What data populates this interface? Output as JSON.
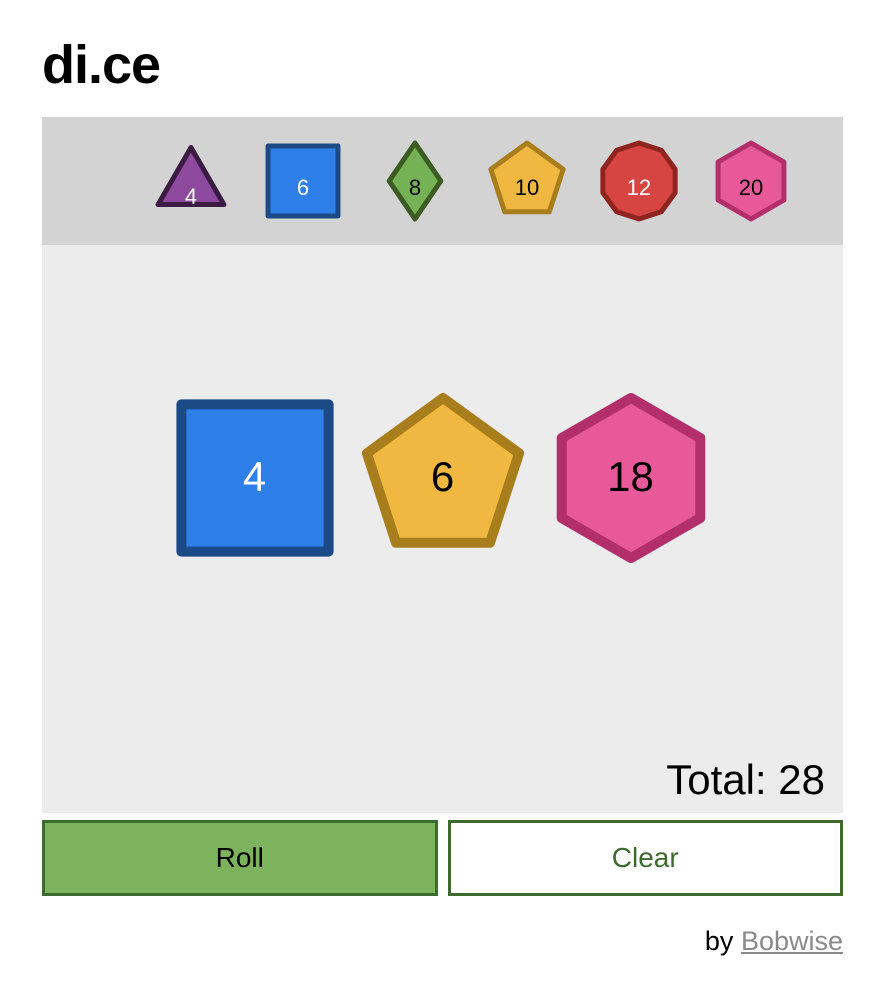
{
  "app": {
    "title": "di.ce"
  },
  "picker": {
    "dice": [
      {
        "sides": "4",
        "label": "4",
        "shape": "triangle",
        "fill": "#8e4a9e",
        "stroke": "#3b1b42",
        "text_color": "#ffffff",
        "icon": "d4-triangle-icon"
      },
      {
        "sides": "6",
        "label": "6",
        "shape": "square",
        "fill": "#2f7fe8",
        "stroke": "#1b4a87",
        "text_color": "#ffffff",
        "icon": "d6-square-icon"
      },
      {
        "sides": "8",
        "label": "8",
        "shape": "diamond",
        "fill": "#74b255",
        "stroke": "#3c5c23",
        "text_color": "#000000",
        "icon": "d8-diamond-icon"
      },
      {
        "sides": "10",
        "label": "10",
        "shape": "pentagon",
        "fill": "#f0b840",
        "stroke": "#a87d1b",
        "text_color": "#000000",
        "icon": "d10-pentagon-icon"
      },
      {
        "sides": "12",
        "label": "12",
        "shape": "decagon",
        "fill": "#d64541",
        "stroke": "#8f2420",
        "text_color": "#ffffff",
        "icon": "d12-decagon-icon"
      },
      {
        "sides": "20",
        "label": "20",
        "shape": "hexagon",
        "fill": "#e8599a",
        "stroke": "#b32f6b",
        "text_color": "#000000",
        "icon": "d20-hexagon-icon"
      }
    ]
  },
  "tray": {
    "rolled": [
      {
        "value": "4",
        "shape": "square",
        "fill": "#2f7fe8",
        "stroke": "#1b4a87",
        "text_color": "#ffffff",
        "icon": "rolled-d6-square-icon"
      },
      {
        "value": "6",
        "shape": "pentagon",
        "fill": "#f0b840",
        "stroke": "#a87d1b",
        "text_color": "#000000",
        "icon": "rolled-d10-pentagon-icon"
      },
      {
        "value": "18",
        "shape": "hexagon",
        "fill": "#e8599a",
        "stroke": "#b32f6b",
        "text_color": "#000000",
        "icon": "rolled-d20-hexagon-icon"
      }
    ],
    "total_text": "Total: 28",
    "total_value": "28"
  },
  "buttons": {
    "roll_label": "Roll",
    "clear_label": "Clear"
  },
  "footer": {
    "prefix": "by ",
    "link_label": "Bobwise"
  },
  "colors": {
    "page_background": "#ffffff",
    "picker_background": "#d3d3d3",
    "tray_background": "#ececec",
    "button_green": "#7cb35c",
    "button_border_green": "#3d6b2e",
    "footer_link": "#8a8a8a"
  }
}
